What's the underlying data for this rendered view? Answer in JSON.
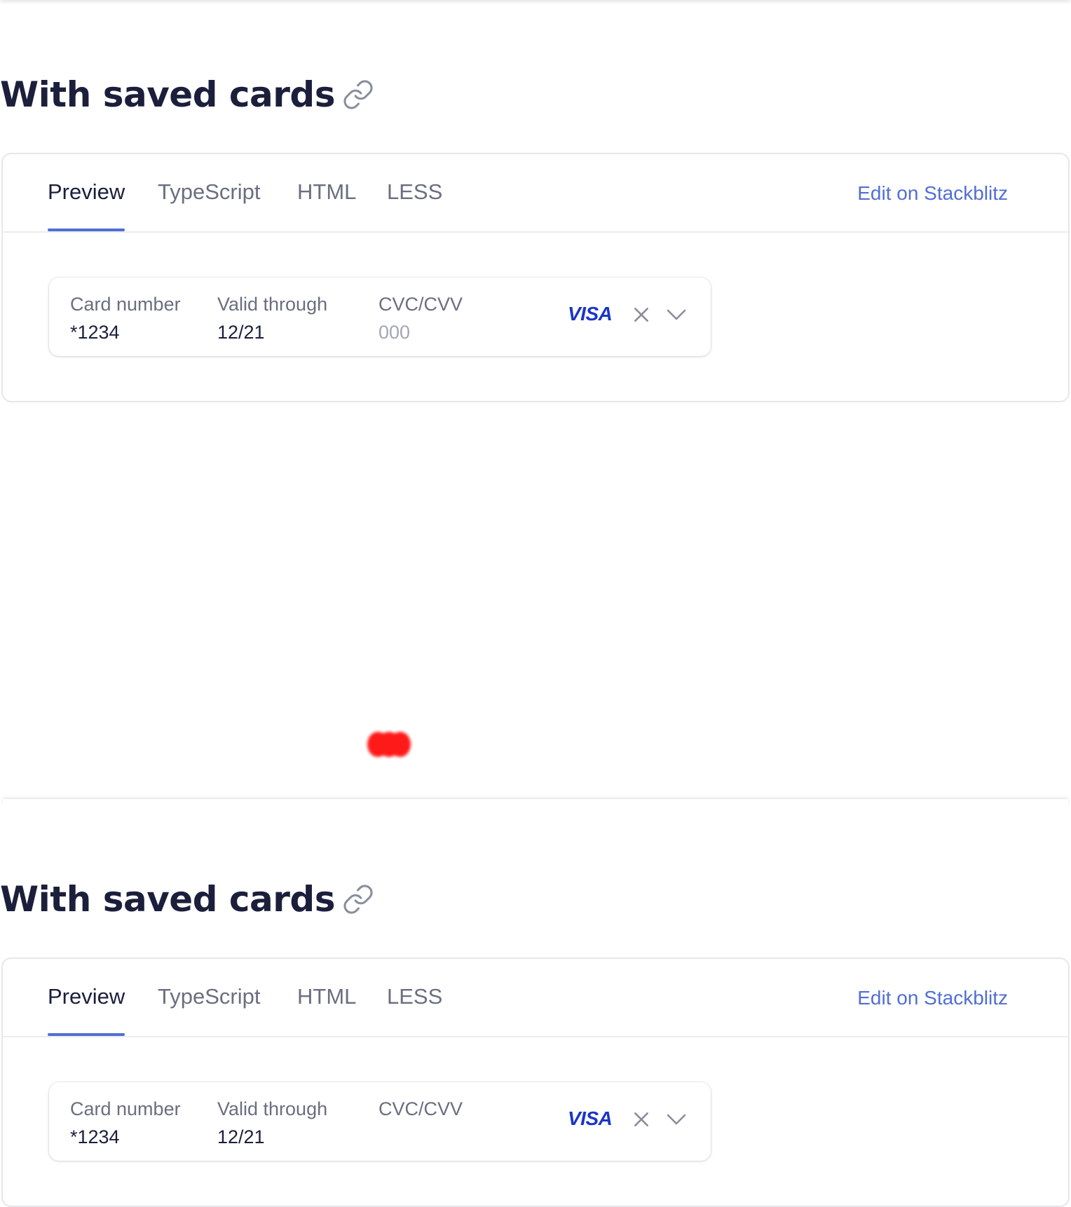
{
  "sections": [
    {
      "title": "With saved cards",
      "tabs": [
        "Preview",
        "TypeScript",
        "HTML",
        "LESS"
      ],
      "active_tab": "Preview",
      "edit_link": "Edit on Stackblitz",
      "card": {
        "number_label": "Card number",
        "number_value": "*1234",
        "expiry_label": "Valid through",
        "expiry_value": "12/21",
        "cvc_label": "CVC/CVV",
        "cvc_placeholder": "000",
        "brand": "VISA"
      }
    },
    {
      "title": "With saved cards",
      "tabs": [
        "Preview",
        "TypeScript",
        "HTML",
        "LESS"
      ],
      "active_tab": "Preview",
      "edit_link": "Edit on Stackblitz",
      "card": {
        "number_label": "Card number",
        "number_value": "*1234",
        "expiry_label": "Valid through",
        "expiry_value": "12/21",
        "cvc_label": "CVC/CVV",
        "cvc_placeholder": "",
        "brand": "VISA"
      }
    }
  ],
  "colors": {
    "accent": "#526ed3",
    "heading": "#1b1f3b",
    "muted": "#6b6e80",
    "visa_blue": "#1a35c9",
    "loader_red": "#ff1a1a"
  },
  "icons": [
    "link-icon",
    "close-icon",
    "chevron-down-icon",
    "loading-dots-icon"
  ]
}
